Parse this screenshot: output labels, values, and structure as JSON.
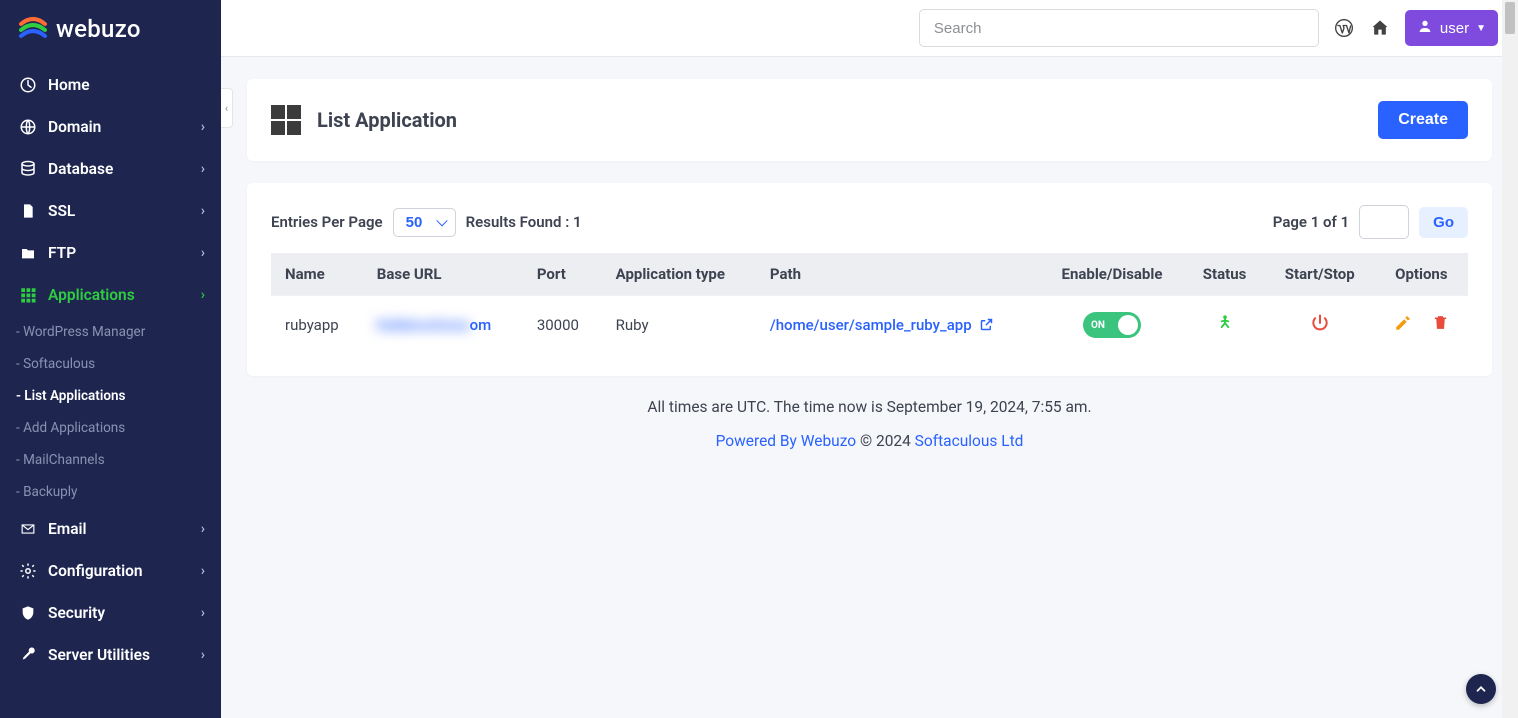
{
  "brand": {
    "name": "webuzo"
  },
  "topbar": {
    "search_placeholder": "Search",
    "user_label": "user"
  },
  "sidebar": {
    "items": [
      {
        "key": "home",
        "label": "Home",
        "has_children": false
      },
      {
        "key": "domain",
        "label": "Domain",
        "has_children": true
      },
      {
        "key": "database",
        "label": "Database",
        "has_children": true
      },
      {
        "key": "ssl",
        "label": "SSL",
        "has_children": true
      },
      {
        "key": "ftp",
        "label": "FTP",
        "has_children": true
      },
      {
        "key": "applications",
        "label": "Applications",
        "has_children": true,
        "children": [
          {
            "label": "WordPress Manager",
            "active": false
          },
          {
            "label": "Softaculous",
            "active": false
          },
          {
            "label": "List Applications",
            "active": true
          },
          {
            "label": "Add Applications",
            "active": false
          },
          {
            "label": "MailChannels",
            "active": false
          },
          {
            "label": "Backuply",
            "active": false
          }
        ]
      },
      {
        "key": "email",
        "label": "Email",
        "has_children": true
      },
      {
        "key": "configuration",
        "label": "Configuration",
        "has_children": true
      },
      {
        "key": "security",
        "label": "Security",
        "has_children": true
      },
      {
        "key": "server-utilities",
        "label": "Server Utilities",
        "has_children": true
      }
    ]
  },
  "page": {
    "title": "List Application",
    "create_btn": "Create",
    "entries_label": "Entries Per Page",
    "entries_value": "50",
    "results_label": "Results Found : 1",
    "page_info": "Page 1 of 1",
    "go_btn": "Go"
  },
  "table": {
    "columns": {
      "name": "Name",
      "base_url": "Base URL",
      "port": "Port",
      "app_type": "Application type",
      "path": "Path",
      "enable": "Enable/Disable",
      "status": "Status",
      "startstop": "Start/Stop",
      "options": "Options"
    },
    "rows": [
      {
        "name": "rubyapp",
        "base_url_hidden": "hiddenurlxxxx",
        "base_url_tail": "om",
        "port": "30000",
        "app_type": "Ruby",
        "path": "/home/user/sample_ruby_app",
        "enabled": true,
        "enabled_label": "ON",
        "running": true
      }
    ]
  },
  "footer": {
    "time_text": "All times are UTC. The time now is September 19, 2024, 7:55 am.",
    "powered_prefix": "Powered By Webuzo",
    "copyright": " © 2024 ",
    "softaculous": "Softaculous Ltd"
  }
}
